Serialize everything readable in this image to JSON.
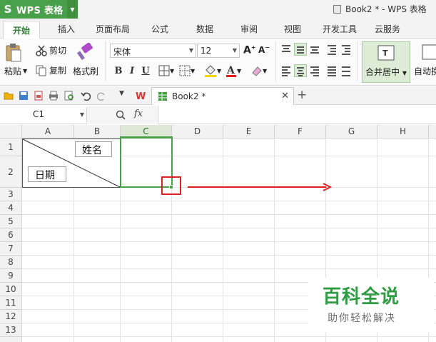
{
  "app": {
    "button_label": "WPS 表格",
    "window_title": "Book2 * - WPS 表格"
  },
  "menu": {
    "tabs": [
      "开始",
      "插入",
      "页面布局",
      "公式",
      "数据",
      "审阅",
      "视图",
      "开发工具",
      "云服务"
    ],
    "active_tab": "开始"
  },
  "ribbon": {
    "paste_label": "粘贴",
    "cut_label": "剪切",
    "copy_label": "复制",
    "format_painter_label": "格式刷",
    "font_name": "宋体",
    "font_size": "12",
    "bold_label": "B",
    "italic_label": "I",
    "underline_label": "U",
    "merge_center_label": "合并居中",
    "autowrap_label": "自动换"
  },
  "quick_access": {
    "doc_tab_label": "Book2 *"
  },
  "formula_bar": {
    "name_box": "C1",
    "fx_label": "fx",
    "formula": ""
  },
  "sheet": {
    "columns": [
      "A",
      "B",
      "C",
      "D",
      "E",
      "F",
      "G",
      "H"
    ],
    "rows": [
      "1",
      "2",
      "3",
      "4",
      "5",
      "6",
      "7",
      "8",
      "9",
      "10",
      "11",
      "12",
      "13"
    ],
    "selected_column": "C",
    "textbox_name": "姓名",
    "textbox_date": "日期"
  },
  "watermark": {
    "title": "百科全说",
    "subtitle": "助你轻松解决"
  },
  "colors": {
    "accent_green": "#4aa04a",
    "annotation_red": "#e02020",
    "watermark_green": "#2f9b43"
  }
}
